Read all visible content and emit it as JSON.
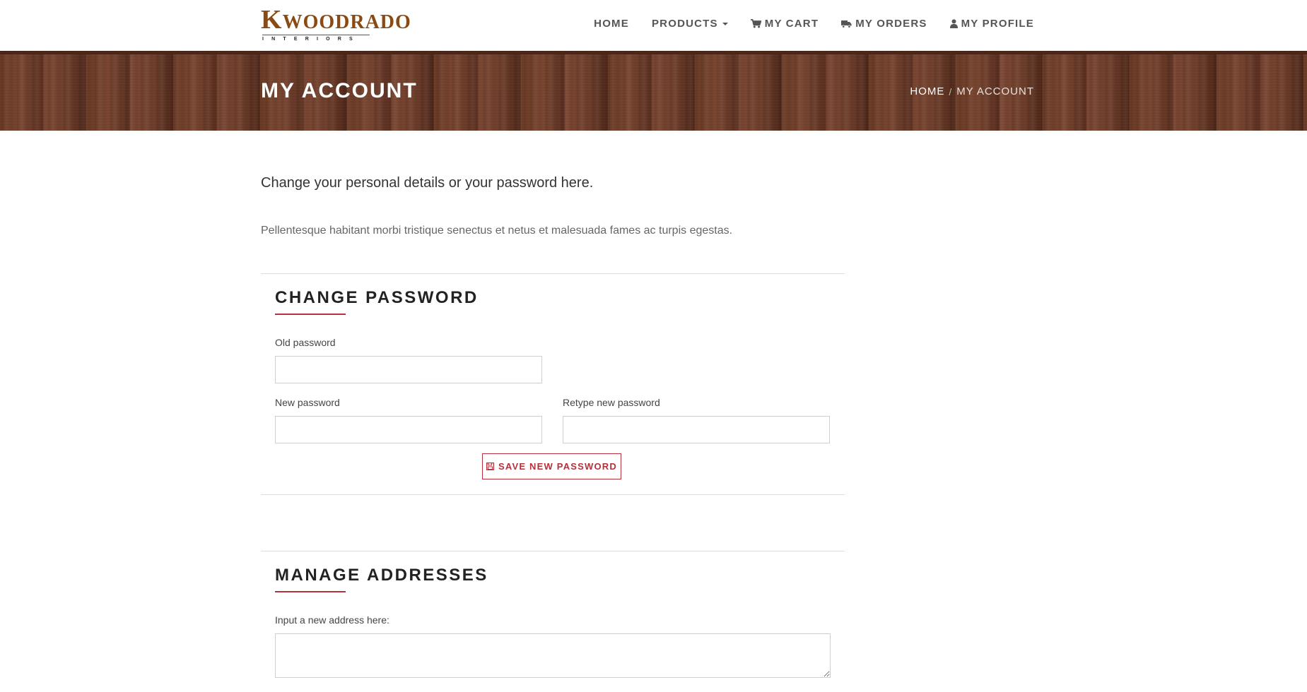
{
  "brand": {
    "logo_main_initial": "K",
    "logo_main_rest": "WOODRADO",
    "logo_sub": "INTERIORS",
    "logo_color": "#8a4a14"
  },
  "nav": {
    "home": "HOME",
    "products": "PRODUCTS",
    "cart": "MY CART",
    "orders": "MY ORDERS",
    "profile": "MY PROFILE",
    "icons": {
      "cart": "cart-icon",
      "orders": "truck-icon",
      "profile": "user-icon",
      "products": "caret-down-icon"
    }
  },
  "banner": {
    "title": "MY ACCOUNT",
    "breadcrumb": [
      "HOME",
      "MY ACCOUNT"
    ]
  },
  "intro": {
    "lead": "Change your personal details or your password here.",
    "text": "Pellentesque habitant morbi tristique senectus et netus et malesuada fames ac turpis egestas."
  },
  "change_password": {
    "heading": "CHANGE PASSWORD",
    "old_label": "Old password",
    "old_value": "",
    "new_label": "New password",
    "new_value": "",
    "retype_label": "Retype new password",
    "retype_value": "",
    "save_label": "SAVE NEW PASSWORD",
    "save_icon": "save-icon"
  },
  "manage_addresses": {
    "heading": "MANAGE ADDRESSES",
    "input_label": "Input a new address here:",
    "input_value": ""
  },
  "colors": {
    "accent": "#b3323c",
    "nav_text": "#555555",
    "banner_wood": "#6b3a24"
  }
}
